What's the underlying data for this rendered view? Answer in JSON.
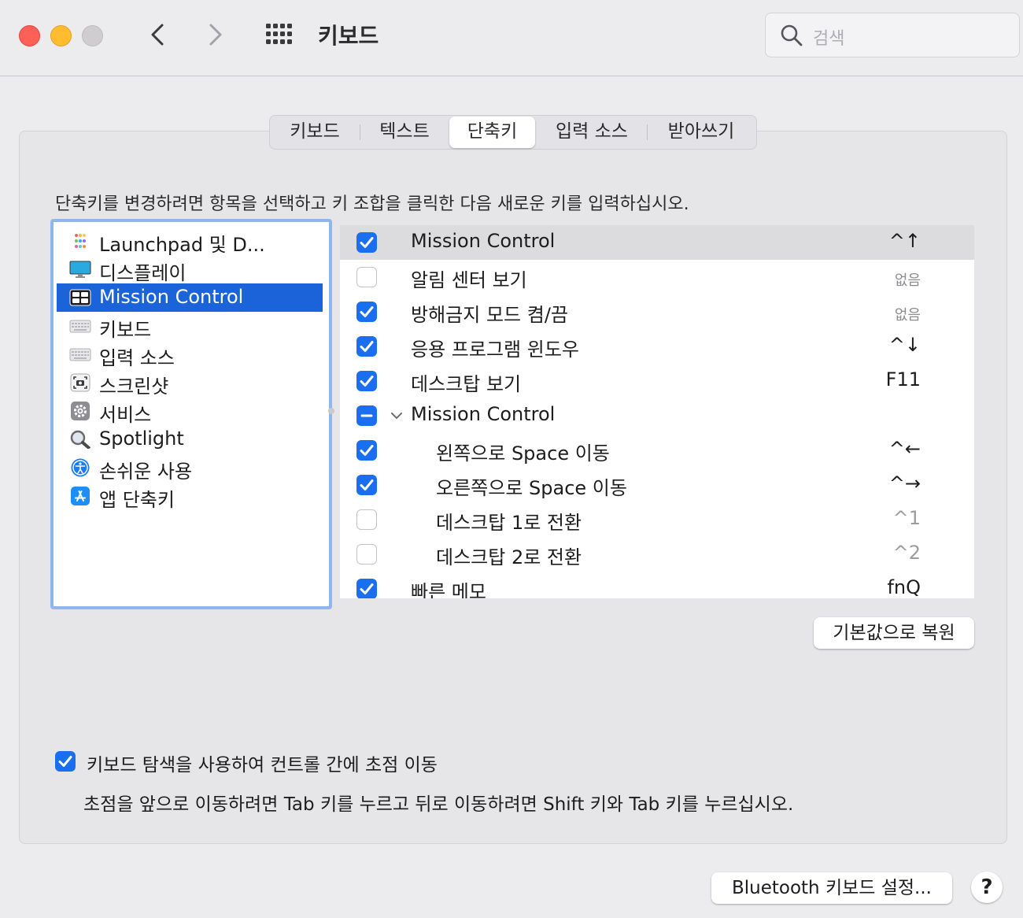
{
  "window": {
    "title": "키보드",
    "search_placeholder": "검색"
  },
  "tabs": [
    {
      "label": "키보드"
    },
    {
      "label": "텍스트"
    },
    {
      "label": "단축키",
      "active": true
    },
    {
      "label": "입력 소스"
    },
    {
      "label": "받아쓰기"
    }
  ],
  "instruction": "단축키를 변경하려면 항목을 선택하고 키 조합을 클릭한 다음 새로운 키를 입력하십시오.",
  "categories": [
    {
      "label": "Launchpad 및 D...",
      "icon": "launchpad-icon"
    },
    {
      "label": "디스플레이",
      "icon": "display-icon"
    },
    {
      "label": "Mission Control",
      "icon": "mission-control-icon",
      "selected": true
    },
    {
      "label": "키보드",
      "icon": "keyboard-icon"
    },
    {
      "label": "입력 소스",
      "icon": "input-source-icon"
    },
    {
      "label": "스크린샷",
      "icon": "screenshot-icon"
    },
    {
      "label": "서비스",
      "icon": "services-gear-icon"
    },
    {
      "label": "Spotlight",
      "icon": "spotlight-magnifier-icon"
    },
    {
      "label": "손쉬운 사용",
      "icon": "accessibility-icon"
    },
    {
      "label": "앱 단축키",
      "icon": "app-store-icon"
    }
  ],
  "shortcuts": [
    {
      "label": "Mission Control",
      "key": "^↑",
      "state": "on",
      "indent": 0
    },
    {
      "label": "알림 센터 보기",
      "key": "없음",
      "state": "off",
      "indent": 0
    },
    {
      "label": "방해금지 모드 켬/끔",
      "key": "없음",
      "state": "on",
      "indent": 0
    },
    {
      "label": "응용 프로그램 윈도우",
      "key": "^↓",
      "state": "on",
      "indent": 0
    },
    {
      "label": "데스크탑 보기",
      "key": "F11",
      "state": "on",
      "indent": 0
    },
    {
      "label": "Mission Control",
      "key": "",
      "state": "mixed",
      "indent": 0,
      "group": true
    },
    {
      "label": "왼쪽으로 Space 이동",
      "key": "^←",
      "state": "on",
      "indent": 1
    },
    {
      "label": "오른쪽으로 Space 이동",
      "key": "^→",
      "state": "on",
      "indent": 1
    },
    {
      "label": "데스크탑 1로 전환",
      "key": "^1",
      "state": "off",
      "indent": 1
    },
    {
      "label": "데스크탑 2로 전환",
      "key": "^2",
      "state": "off",
      "indent": 1
    },
    {
      "label": "빠른 메모",
      "key": "fnQ",
      "state": "on",
      "indent": 0
    }
  ],
  "restore_button": "기본값으로 복원",
  "keyboard_nav": {
    "checked": true,
    "label": "키보드 탐색을 사용하여 컨트롤 간에 초점 이동",
    "hint": "초점을 앞으로 이동하려면 Tab 키를 누르고 뒤로 이동하려면 Shift 키와 Tab 키를 누르십시오."
  },
  "bluetooth_button": "Bluetooth 키보드 설정...",
  "help_button": "?",
  "colors": {
    "accent": "#1a6ff0",
    "selection": "#1a63d8",
    "close": "#fe5f57",
    "minimize": "#febc2e"
  }
}
